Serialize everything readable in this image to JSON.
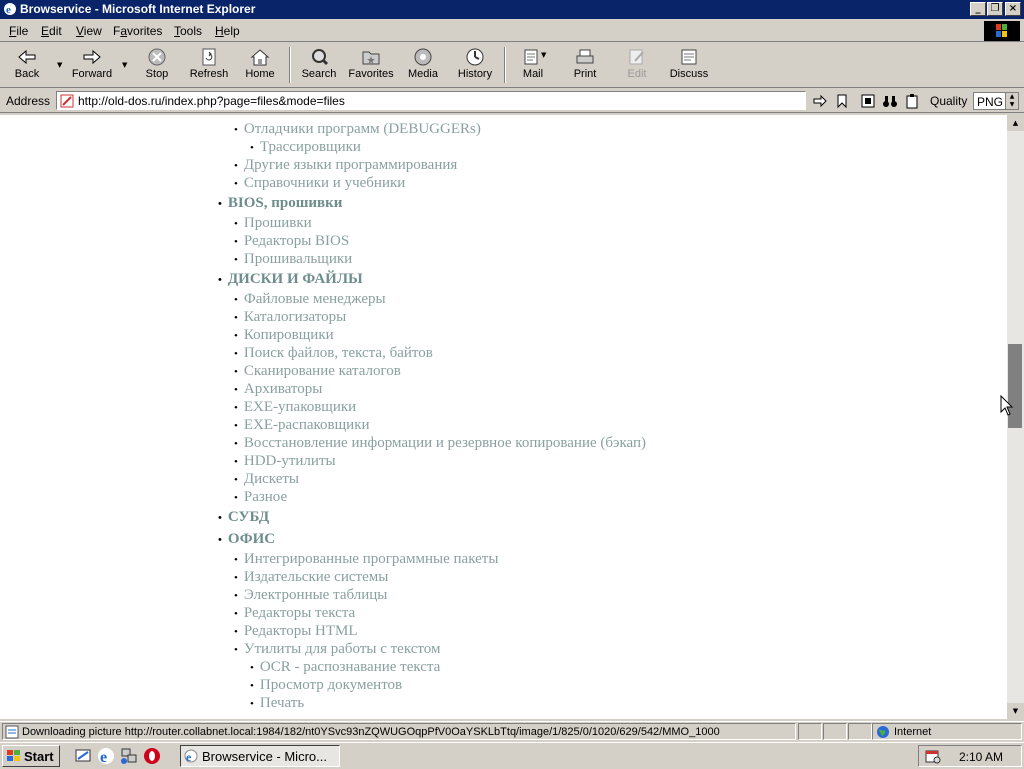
{
  "window": {
    "title": "Browservice - Microsoft Internet Explorer"
  },
  "menu": [
    {
      "label": "File",
      "u": "F",
      "rest": "ile"
    },
    {
      "label": "Edit",
      "u": "E",
      "rest": "dit"
    },
    {
      "label": "View",
      "u": "V",
      "rest": "iew"
    },
    {
      "label": "Favorites",
      "u": "F",
      "rest": "avorites",
      "alt": "Fa"
    },
    {
      "label": "Tools",
      "u": "T",
      "rest": "ools"
    },
    {
      "label": "Help",
      "u": "H",
      "rest": "elp"
    }
  ],
  "toolbar": {
    "back": "Back",
    "forward": "Forward",
    "stop": "Stop",
    "refresh": "Refresh",
    "home": "Home",
    "search": "Search",
    "favorites": "Favorites",
    "media": "Media",
    "history": "History",
    "mail": "Mail",
    "print": "Print",
    "edit": "Edit",
    "discuss": "Discuss"
  },
  "address": {
    "label": "Address",
    "url": "http://old-dos.ru/index.php?page=files&mode=files",
    "quality_label": "Quality",
    "quality_value": "PNG"
  },
  "content": [
    {
      "level": 2,
      "text": "Отладчики программ (DEBUGGERs)"
    },
    {
      "level": 3,
      "text": "Трассировщики"
    },
    {
      "level": 2,
      "text": "Другие языки программирования"
    },
    {
      "level": 2,
      "text": "Справочники и учебники"
    },
    {
      "level": 1,
      "text": "BIOS, прошивки"
    },
    {
      "level": 2,
      "text": "Прошивки"
    },
    {
      "level": 2,
      "text": "Редакторы BIOS"
    },
    {
      "level": 2,
      "text": "Прошивальщики"
    },
    {
      "level": 1,
      "text": "ДИСКИ И ФАЙЛЫ"
    },
    {
      "level": 2,
      "text": "Файловые менеджеры"
    },
    {
      "level": 2,
      "text": "Каталогизаторы"
    },
    {
      "level": 2,
      "text": "Копировщики"
    },
    {
      "level": 2,
      "text": "Поиск файлов, текста, байтов"
    },
    {
      "level": 2,
      "text": "Сканирование каталогов"
    },
    {
      "level": 2,
      "text": "Архиваторы"
    },
    {
      "level": 2,
      "text": "EXE-упаковщики"
    },
    {
      "level": 2,
      "text": "EXE-распаковщики"
    },
    {
      "level": 2,
      "text": "Восстановление информации и резервное копирование (бэкап)"
    },
    {
      "level": 2,
      "text": "HDD-утилиты"
    },
    {
      "level": 2,
      "text": "Дискеты"
    },
    {
      "level": 2,
      "text": "Разное"
    },
    {
      "level": 1,
      "text": "СУБД"
    },
    {
      "level": 1,
      "text": "ОФИС"
    },
    {
      "level": 2,
      "text": "Интегрированные программные пакеты"
    },
    {
      "level": 2,
      "text": "Издательские системы"
    },
    {
      "level": 2,
      "text": "Электронные таблицы"
    },
    {
      "level": 2,
      "text": "Редакторы текста"
    },
    {
      "level": 2,
      "text": "Редакторы HTML"
    },
    {
      "level": 2,
      "text": "Утилиты для работы с текстом"
    },
    {
      "level": 3,
      "text": "OCR - распознавание текста"
    },
    {
      "level": 3,
      "text": "Просмотр документов"
    },
    {
      "level": 3,
      "text": "Печать"
    }
  ],
  "status": {
    "text": "Downloading picture http://router.collabnet.local:1984/182/nt0YSvc93nZQWUGOqpPfV0OaYSKLbTtq/image/1/825/0/1020/629/542/MMO_1000",
    "zone": "Internet"
  },
  "taskbar": {
    "start": "Start",
    "task": "Browservice - Micro...",
    "clock": "2:10 AM"
  },
  "colors": {
    "titlebar": "#0a246a",
    "link": "#8aa0a0",
    "category": "#6f8d8d",
    "chrome": "#d4d0c8"
  }
}
